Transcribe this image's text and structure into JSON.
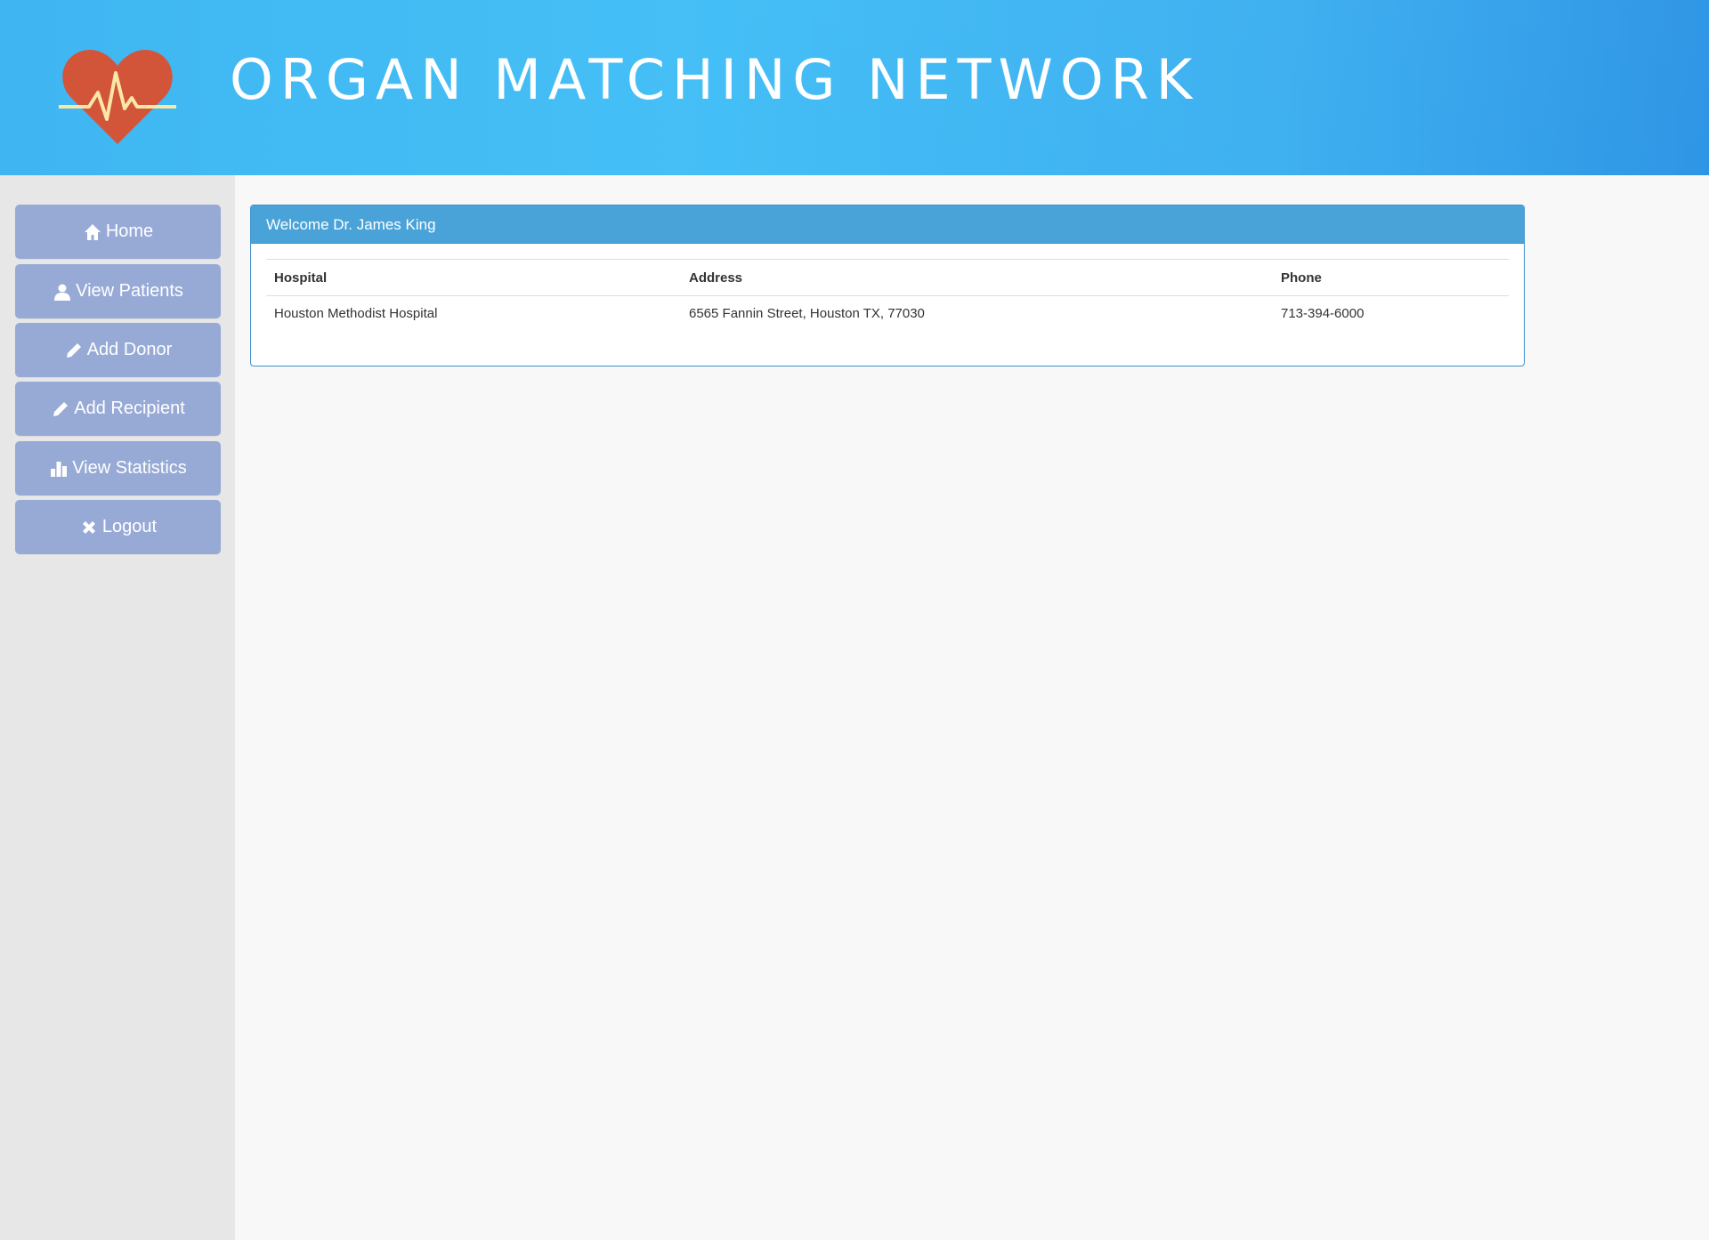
{
  "header": {
    "title": "ORGAN MATCHING NETWORK",
    "logo_icon": "heart-pulse-icon",
    "colors": {
      "gradient_start": "#3fb6f1",
      "gradient_end": "#2490e4",
      "heart": "#d2553a",
      "pulse": "#fbe7a6"
    }
  },
  "sidebar": {
    "background": "#e7e7e7",
    "button_color": "#97aad6",
    "items": [
      {
        "label": "Home",
        "icon": "home-icon"
      },
      {
        "label": "View Patients",
        "icon": "user-icon"
      },
      {
        "label": "Add Donor",
        "icon": "pencil-icon"
      },
      {
        "label": "Add Recipient",
        "icon": "pencil-icon"
      },
      {
        "label": "View Statistics",
        "icon": "bar-chart-icon"
      },
      {
        "label": "Logout",
        "icon": "close-icon"
      }
    ]
  },
  "panel": {
    "heading": "Welcome Dr. James King",
    "accent": "#4aa3d8",
    "columns": [
      "Hospital",
      "Address",
      "Phone"
    ],
    "rows": [
      [
        "Houston Methodist Hospital",
        "6565 Fannin Street, Houston TX, 77030",
        "713-394-6000"
      ]
    ]
  }
}
